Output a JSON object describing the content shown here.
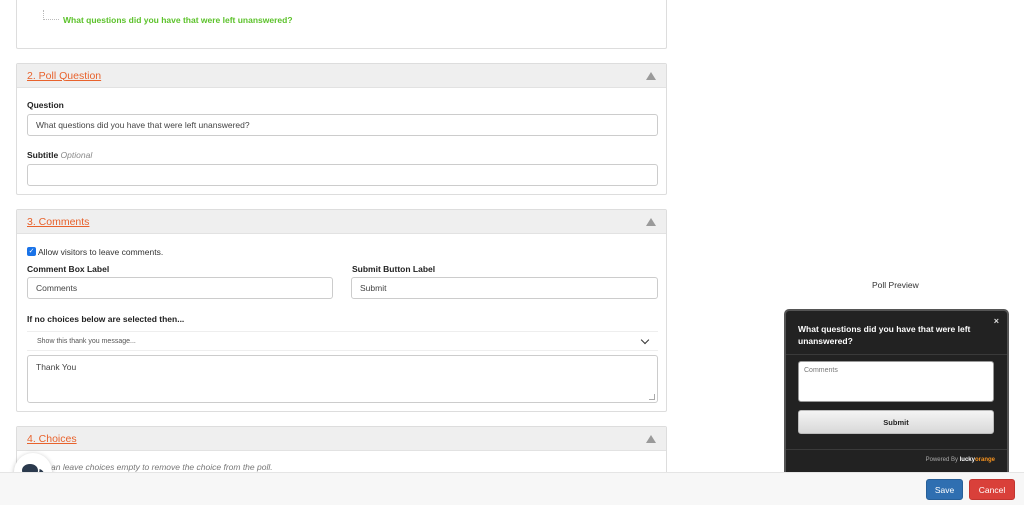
{
  "top_section": {
    "answer_item": "What questions did you have that were left unanswered?"
  },
  "poll_question": {
    "title": "2. Poll Question",
    "question_label": "Question",
    "question_value": "What questions did you have that were left unanswered?",
    "subtitle_label": "Subtitle",
    "subtitle_optional": "Optional",
    "subtitle_value": ""
  },
  "comments": {
    "title": "3. Comments",
    "allow_label": "Allow visitors to leave comments.",
    "allow_checked": true,
    "comment_box_label": "Comment Box Label",
    "comment_box_value": "Comments",
    "submit_button_label": "Submit Button Label",
    "submit_button_value": "Submit",
    "if_no_choices_label": "If no choices below are selected then...",
    "select_value": "Show this thank you message...",
    "thank_you_value": "Thank You"
  },
  "choices": {
    "title": "4. Choices",
    "note": "an leave choices empty to remove the choice from the poll."
  },
  "preview": {
    "label": "Poll Preview",
    "question": "What questions did you have that were left unanswered?",
    "close": "×",
    "comments_placeholder": "Comments",
    "submit": "Submit",
    "powered_by": "Powered By",
    "brand_lucky": "lucky",
    "brand_orange": "orange"
  },
  "footer": {
    "save": "Save",
    "cancel": "Cancel"
  },
  "icons": {
    "chat": "chat-bubbles-icon",
    "collapse": "caret-up-icon",
    "select": "chevron-down-icon"
  },
  "colors": {
    "accent": "#e8622c",
    "green": "#5cc22b",
    "save": "#2f6fb1",
    "cancel": "#d9403a"
  }
}
